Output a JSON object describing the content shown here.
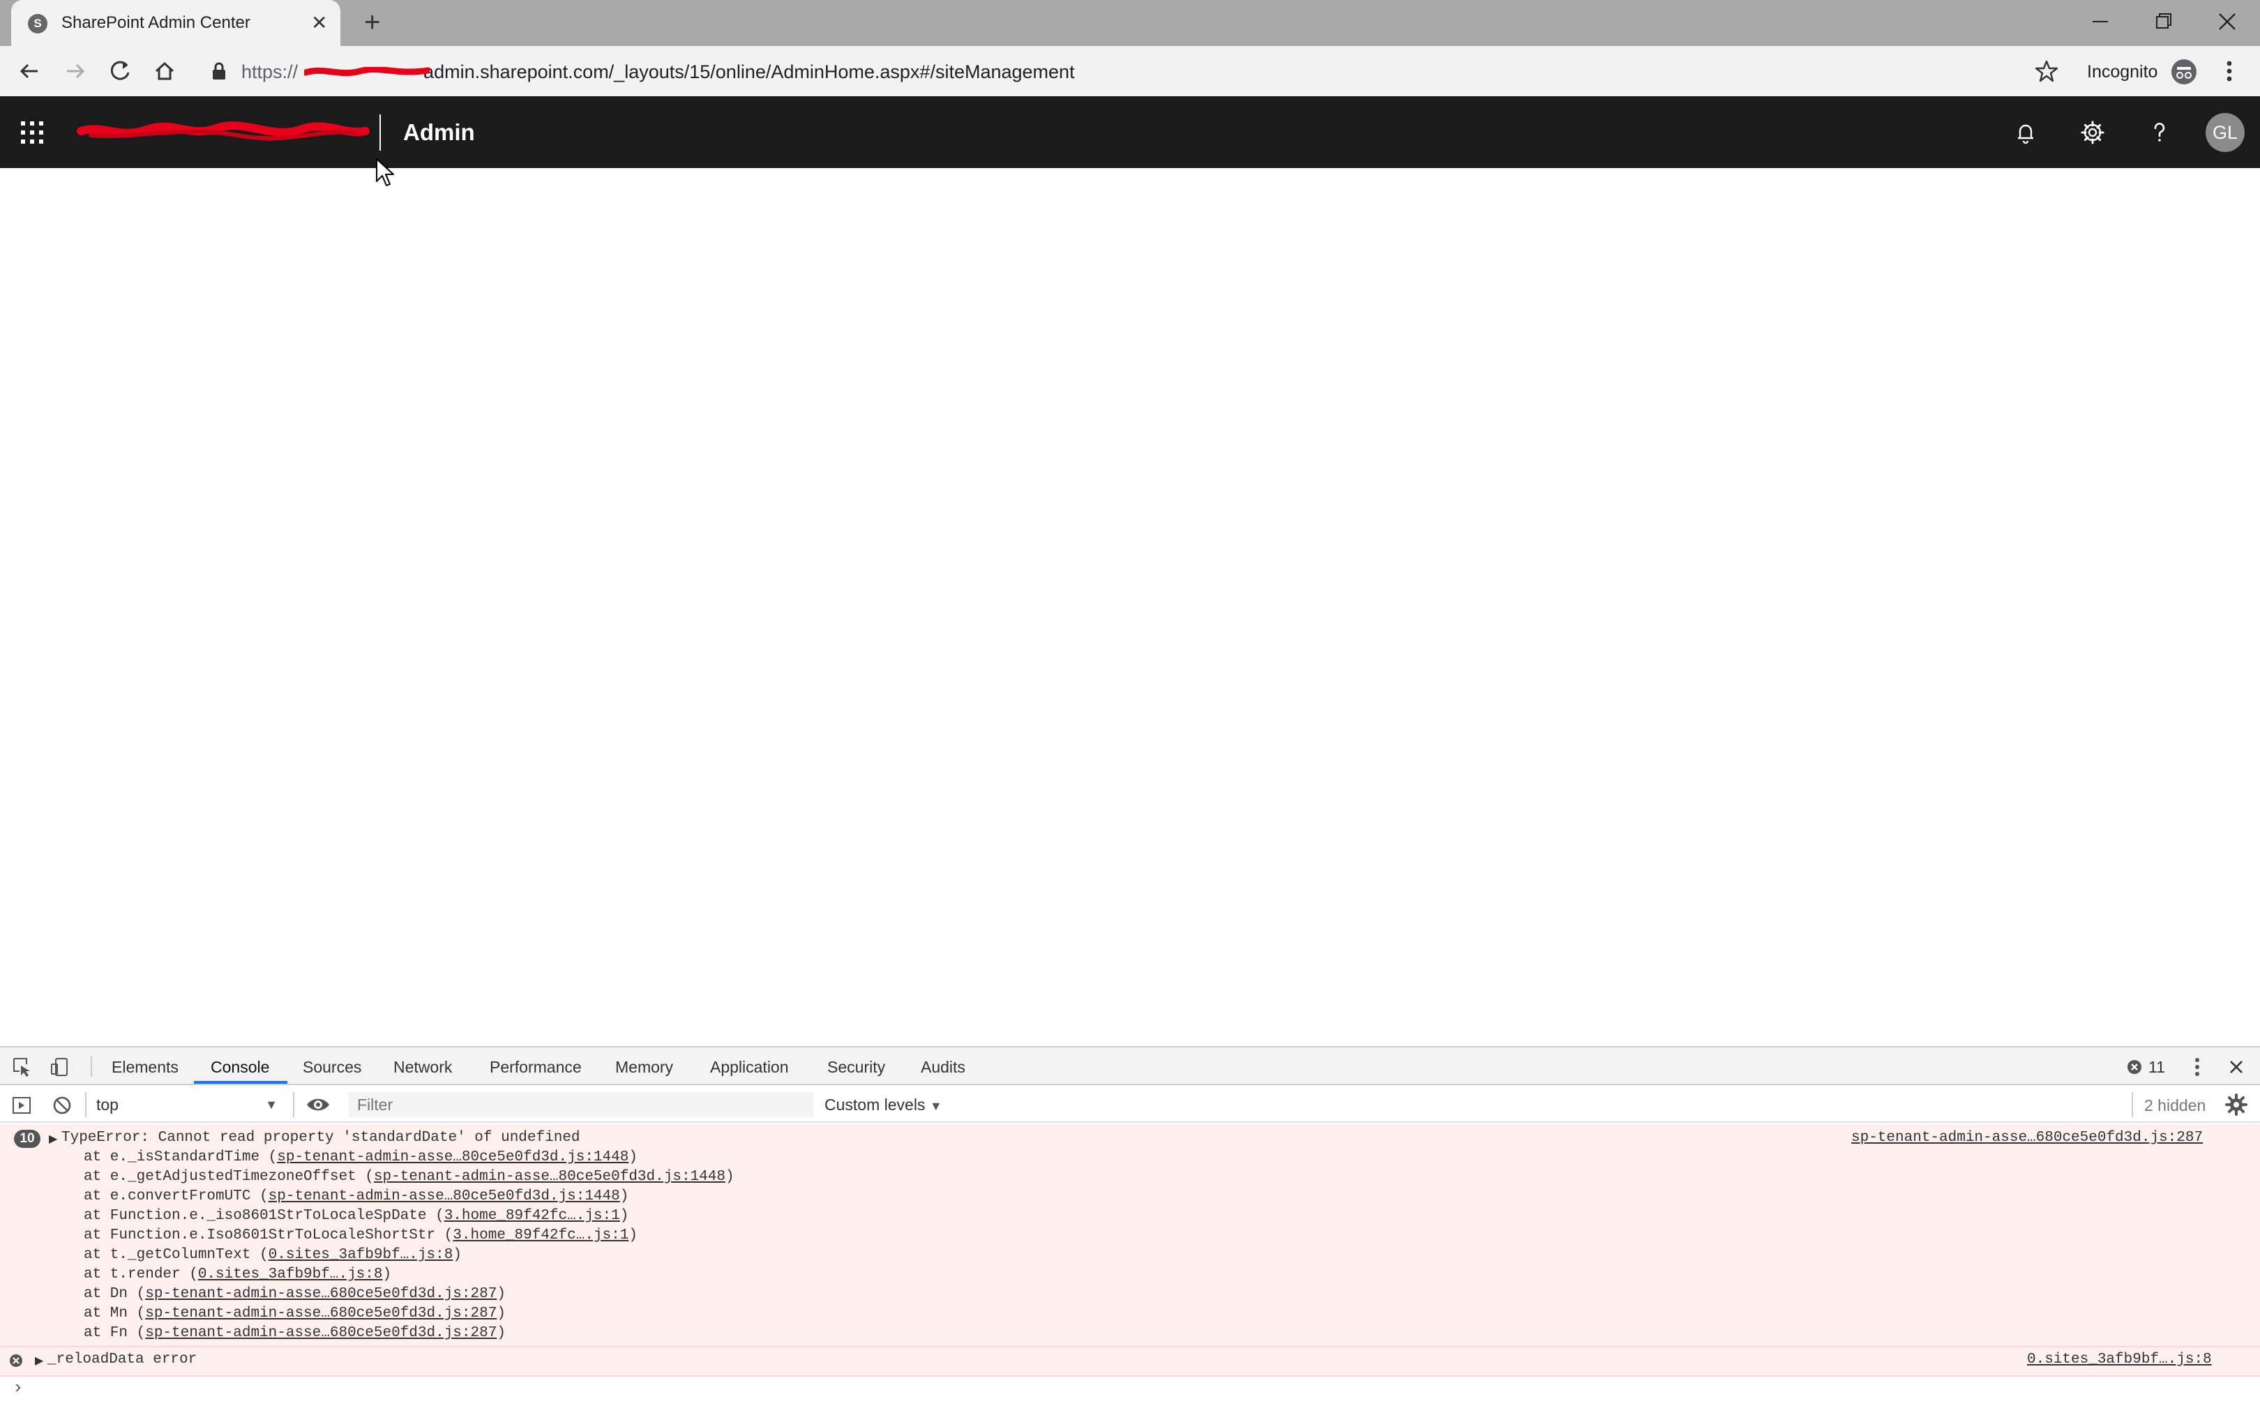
{
  "browser": {
    "tab_title": "SharePoint Admin Center",
    "tab_close": "✕",
    "new_tab": "+",
    "url": {
      "scheme": "https://",
      "rest": "admin.sharepoint.com/_layouts/15/online/AdminHome.aspx#/siteManagement"
    },
    "profile_label": "Incognito"
  },
  "sharepoint": {
    "title": "Admin",
    "avatar_initials": "GL"
  },
  "devtools": {
    "tabs": [
      "Elements",
      "Console",
      "Sources",
      "Network",
      "Performance",
      "Memory",
      "Application",
      "Security",
      "Audits"
    ],
    "active_tab": "Console",
    "error_count": "11",
    "context": "top",
    "filter_placeholder": "Filter",
    "levels": "Custom levels",
    "hidden": "2 hidden",
    "console": {
      "entry1": {
        "repeat_count": "10",
        "message": "TypeError: Cannot read property 'standardDate' of undefined",
        "source": "sp-tenant-admin-asse…680ce5e0fd3d.js:287",
        "trace": [
          {
            "fn": "at e._isStandardTime (",
            "loc": "sp-tenant-admin-asse…80ce5e0fd3d.js:1448",
            "end": ")"
          },
          {
            "fn": "at e._getAdjustedTimezoneOffset (",
            "loc": "sp-tenant-admin-asse…80ce5e0fd3d.js:1448",
            "end": ")"
          },
          {
            "fn": "at e.convertFromUTC (",
            "loc": "sp-tenant-admin-asse…80ce5e0fd3d.js:1448",
            "end": ")"
          },
          {
            "fn": "at Function.e._iso8601StrToLocaleSpDate (",
            "loc": "3.home_89f42fc….js:1",
            "end": ")"
          },
          {
            "fn": "at Function.e.Iso8601StrToLocaleShortStr (",
            "loc": "3.home_89f42fc….js:1",
            "end": ")"
          },
          {
            "fn": "at t._getColumnText (",
            "loc": "0.sites_3afb9bf….js:8",
            "end": ")"
          },
          {
            "fn": "at t.render (",
            "loc": "0.sites_3afb9bf….js:8",
            "end": ")"
          },
          {
            "fn": "at Dn (",
            "loc": "sp-tenant-admin-asse…680ce5e0fd3d.js:287",
            "end": ")"
          },
          {
            "fn": "at Mn (",
            "loc": "sp-tenant-admin-asse…680ce5e0fd3d.js:287",
            "end": ")"
          },
          {
            "fn": "at Fn (",
            "loc": "sp-tenant-admin-asse…680ce5e0fd3d.js:287",
            "end": ")"
          }
        ]
      },
      "entry2": {
        "message": "_reloadData error",
        "source": "0.sites_3afb9bf….js:8"
      },
      "prompt": "›"
    }
  },
  "colors": {
    "header_bg": "#1b1b1b",
    "tab_strip": "#a9a9a9",
    "error_bg": "#fff0f0",
    "accent": "#1a73e8",
    "redaction": "#e8001a"
  }
}
